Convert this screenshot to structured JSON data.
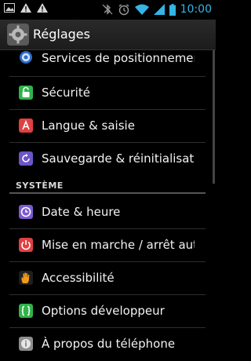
{
  "status_bar": {
    "time": "10:00",
    "left_icons": [
      "image-icon",
      "warning-icon",
      "warning-icon"
    ],
    "right_icons": [
      "bluetooth-muted-icon",
      "alarm-icon",
      "wifi-icon",
      "signal-icon",
      "battery-icon"
    ]
  },
  "action_bar": {
    "title": "Réglages",
    "icon": "settings-gear-icon"
  },
  "items": [
    {
      "label": "Services de positionnement",
      "icon": "location-icon",
      "color": "#3b7fd9"
    },
    {
      "label": "Sécurité",
      "icon": "lock-icon",
      "color": "#2fb34a"
    },
    {
      "label": "Langue & saisie",
      "icon": "language-icon",
      "color": "#e04040"
    },
    {
      "label": "Sauvegarde & réinitialisation",
      "icon": "backup-icon",
      "color": "#6b55c8"
    }
  ],
  "section": {
    "title": "SYSTÈME"
  },
  "system_items": [
    {
      "label": "Date & heure",
      "icon": "clock-icon",
      "color": "#7b5ad1"
    },
    {
      "label": "Mise en marche / arrêt automatique",
      "icon": "power-schedule-icon",
      "color": "#e04040"
    },
    {
      "label": "Accessibilité",
      "icon": "hand-icon",
      "color": "#f29a1a"
    },
    {
      "label": "Options développeur",
      "icon": "braces-icon",
      "color": "#2fb34a"
    },
    {
      "label": "À propos du téléphone",
      "icon": "info-icon",
      "color": "#9a9a9a"
    }
  ]
}
